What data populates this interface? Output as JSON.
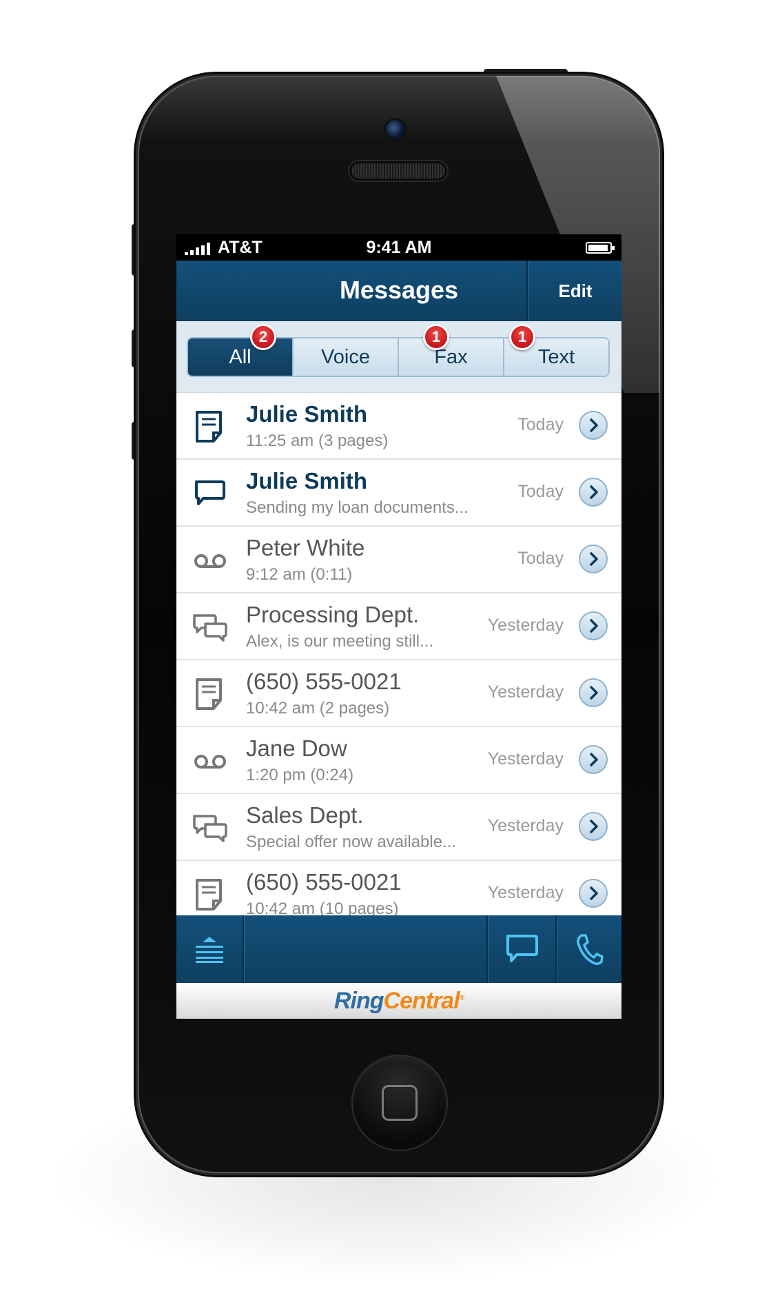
{
  "status_bar": {
    "carrier": "AT&T",
    "time": "9:41 AM"
  },
  "nav": {
    "title": "Messages",
    "edit_label": "Edit"
  },
  "filter_tabs": [
    {
      "label": "All",
      "badge": "2",
      "active": true
    },
    {
      "label": "Voice",
      "badge": "",
      "active": false
    },
    {
      "label": "Fax",
      "badge": "1",
      "active": false
    },
    {
      "label": "Text",
      "badge": "1",
      "active": false
    }
  ],
  "messages": [
    {
      "type": "fax",
      "name": "Julie Smith",
      "detail": "11:25 am (3 pages)",
      "date": "Today",
      "unread": true
    },
    {
      "type": "text",
      "name": "Julie Smith",
      "detail": "Sending my loan documents...",
      "date": "Today",
      "unread": true
    },
    {
      "type": "voicemail",
      "name": "Peter White",
      "detail": "9:12 am (0:11)",
      "date": "Today",
      "unread": false
    },
    {
      "type": "group-text",
      "name": "Processing Dept.",
      "detail": "Alex, is our meeting still...",
      "date": "Yesterday",
      "unread": false
    },
    {
      "type": "fax",
      "name": "(650) 555-0021",
      "detail": "10:42 am (2 pages)",
      "date": "Yesterday",
      "unread": false
    },
    {
      "type": "voicemail",
      "name": "Jane Dow",
      "detail": "1:20 pm (0:24)",
      "date": "Yesterday",
      "unread": false
    },
    {
      "type": "group-text",
      "name": "Sales Dept.",
      "detail": "Special offer now available...",
      "date": "Yesterday",
      "unread": false
    },
    {
      "type": "fax",
      "name": "(650) 555-0021",
      "detail": "10:42 am (10 pages)",
      "date": "Yesterday",
      "unread": false
    }
  ],
  "toolbar": {
    "icons": [
      "menu-icon",
      "compose-message-icon",
      "phone-icon"
    ]
  },
  "footer": {
    "logo_part1": "Ring",
    "logo_part2": "Central",
    "logo_mark": "®"
  },
  "colors": {
    "nav_blue": "#0e3f60",
    "accent_light": "#dfe9f1",
    "badge_red": "#c4161c",
    "brand_blue": "#2e6ea3",
    "brand_orange": "#f08a1c"
  }
}
